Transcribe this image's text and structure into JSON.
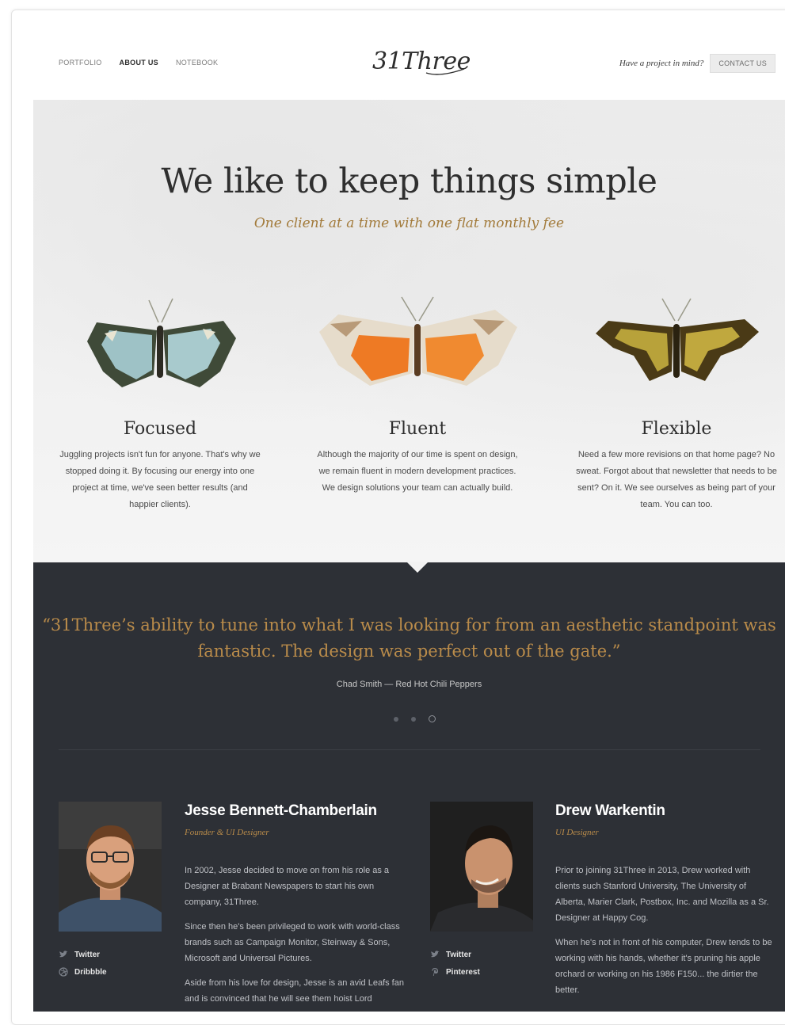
{
  "nav": {
    "items": [
      {
        "label": "PORTFOLIO",
        "active": false
      },
      {
        "label": "ABOUT US",
        "active": true
      },
      {
        "label": "NOTEBOOK",
        "active": false
      }
    ],
    "logo": "31Three",
    "prompt": "Have a project in mind?",
    "contact_label": "CONTACT US"
  },
  "hero": {
    "title": "We like to keep things simple",
    "subtitle": "One client at a time with one flat monthly fee",
    "features": [
      {
        "icon": "blue-butterfly-illustration",
        "title": "Focused",
        "text": "Juggling projects isn't fun for anyone. That's why we stopped doing it. By focusing our energy into one project at time, we've seen better results (and happier clients)."
      },
      {
        "icon": "orange-butterfly-illustration",
        "title": "Fluent",
        "text": "Although the majority of our time is spent on design, we remain fluent in modern development practices. We design solutions your team can actually build."
      },
      {
        "icon": "olive-butterfly-illustration",
        "title": "Flexible",
        "text": "Need a few more revisions on that home page? No sweat. Forgot about that newsletter that needs to be sent? On it. We see ourselves as being part of your team. You can too."
      }
    ]
  },
  "testimonial": {
    "quote": "“31Three’s ability to tune into what I was looking for from an aesthetic standpoint was fantastic. The design was perfect out of the gate.”",
    "author": "Chad Smith — Red Hot Chili Peppers",
    "active_dot": 3
  },
  "team": [
    {
      "name": "Jesse Bennett-Chamberlain",
      "role": "Founder & UI Designer",
      "social": [
        {
          "icon": "twitter-icon",
          "label": "Twitter"
        },
        {
          "icon": "dribbble-icon",
          "label": "Dribbble"
        }
      ],
      "bio": [
        "In 2002, Jesse decided to move on from his role as a Designer at Brabant Newspapers to start his own company, 31Three.",
        "Since then he's been privileged to work with world-class brands such as Campaign Monitor, Steinway & Sons, Microsoft and Universal Pictures.",
        "Aside from his love for design, Jesse is an avid Leafs fan and is convinced that he will see them hoist Lord"
      ]
    },
    {
      "name": "Drew Warkentin",
      "role": "UI Designer",
      "social": [
        {
          "icon": "twitter-icon",
          "label": "Twitter"
        },
        {
          "icon": "pinterest-icon",
          "label": "Pinterest"
        }
      ],
      "bio": [
        "Prior to joining 31Three in 2013, Drew worked with clients such Stanford University, The University of Alberta, Marier Clark, Postbox, Inc. and Mozilla as a Sr. Designer at Happy Cog.",
        "When he's not in front of his computer, Drew tends to be working with his hands, whether it's pruning his apple orchard or working on his 1986 F150... the dirtier the better."
      ]
    }
  ],
  "colors": {
    "accent_gold": "#b98b4a",
    "dark_panel": "#2d3036",
    "hero_bg": "#efefef"
  }
}
